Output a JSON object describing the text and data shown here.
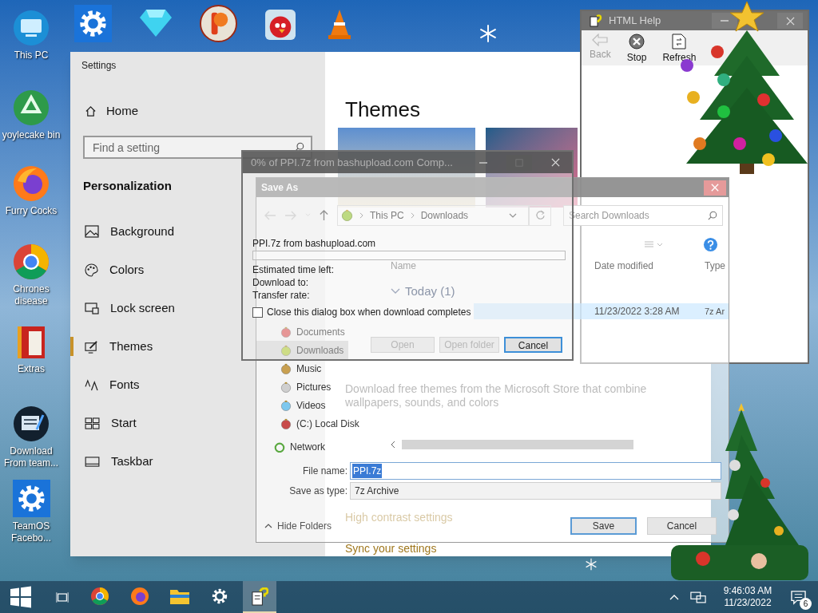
{
  "desktop_icons": [
    {
      "label": "This PC"
    },
    {
      "label": "yoylecake bin"
    },
    {
      "label": "Furry Cocks"
    },
    {
      "label": "Chrones disease"
    },
    {
      "label": "Extras"
    },
    {
      "label": "Download From team..."
    },
    {
      "label": "TeamOS Facebo..."
    }
  ],
  "settings": {
    "title": "Settings",
    "home": "Home",
    "search": {
      "placeholder": "Find a setting"
    },
    "section": "Personalization",
    "nav": [
      {
        "label": "Background",
        "selected": false
      },
      {
        "label": "Colors",
        "selected": false
      },
      {
        "label": "Lock screen",
        "selected": false
      },
      {
        "label": "Themes",
        "selected": true
      },
      {
        "label": "Fonts",
        "selected": false
      },
      {
        "label": "Start",
        "selected": false
      },
      {
        "label": "Taskbar",
        "selected": false
      }
    ],
    "heading": "Themes",
    "description": "Download free themes from the Microsoft Store that combine wallpapers, sounds, and colors",
    "links": [
      "High contrast settings",
      "Sync your settings"
    ]
  },
  "help_window": {
    "title": "HTML Help",
    "toolbar": [
      {
        "label": "Back",
        "disabled": true
      },
      {
        "label": "Stop",
        "disabled": false
      },
      {
        "label": "Refresh",
        "disabled": false
      }
    ]
  },
  "save_as": {
    "title": "Save As",
    "path": [
      "This PC",
      "Downloads"
    ],
    "search": {
      "placeholder": "Search Downloads"
    },
    "columns": [
      "Name",
      "Date modified",
      "Type"
    ],
    "group": "Today (1)",
    "rows": [
      {
        "date": "11/23/2022 3:28 AM",
        "type": "7z Ar",
        "selected": true
      }
    ],
    "folders": [
      {
        "label": "Documents",
        "selected": false
      },
      {
        "label": "Downloads",
        "selected": true
      },
      {
        "label": "Music",
        "selected": false
      },
      {
        "label": "Pictures",
        "selected": false
      },
      {
        "label": "Videos",
        "selected": false
      },
      {
        "label": "(C:) Local Disk",
        "selected": false
      }
    ],
    "network": "Network",
    "file_name": {
      "label": "File name:",
      "value": "PPI.7z"
    },
    "save_as_type": {
      "label": "Save as type:",
      "value": "7z Archive"
    },
    "hide_folders": "Hide Folders",
    "buttons": [
      "Save",
      "Cancel"
    ]
  },
  "download_dialog": {
    "title": "0% of PPI.7z from bashupload.com Comp...",
    "source": "PPI.7z from bashupload.com",
    "level": 0,
    "fields": [
      "Estimated time left:",
      "Download to:",
      "Transfer rate:"
    ],
    "close_when_done": {
      "label": "Close this dialog box when download completes",
      "checked": false
    },
    "buttons": [
      {
        "label": "Open",
        "disabled": true
      },
      {
        "label": "Open folder",
        "disabled": true
      },
      {
        "label": "Cancel",
        "disabled": false
      }
    ]
  },
  "taskbar": {
    "apps": [
      {
        "active": false
      },
      {
        "active": false
      },
      {
        "active": false
      },
      {
        "active": false
      },
      {
        "active": true
      }
    ],
    "clock": {
      "time": "9:46:03 AM",
      "date": "11/23/2022"
    },
    "notifications": "6"
  }
}
